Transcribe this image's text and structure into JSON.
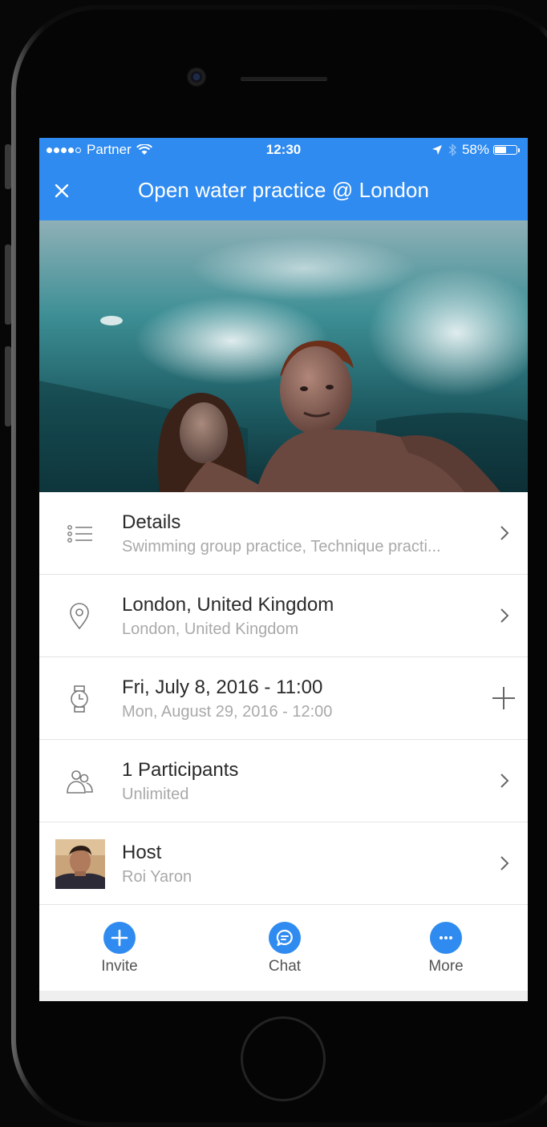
{
  "colors": {
    "accent": "#2f8bf0",
    "subtext": "#a9a9a9",
    "title": "#2a2a2a"
  },
  "status_bar": {
    "carrier": "Partner",
    "time": "12:30",
    "battery": "58%",
    "battery_level": 0.58
  },
  "header": {
    "title": "Open water practice @ London",
    "close_icon": "close-icon"
  },
  "hero": {
    "alt": "underwater swimmers photo"
  },
  "rows": [
    {
      "icon": "list-icon",
      "title": "Details",
      "subtitle": "Swimming group practice, Technique practi...",
      "action": "chevron-right-icon"
    },
    {
      "icon": "location-pin-icon",
      "title": "London, United Kingdom",
      "subtitle": "London, United Kingdom",
      "action": "chevron-right-icon"
    },
    {
      "icon": "watch-icon",
      "title": "Fri, July 8, 2016 - 11:00",
      "subtitle": "Mon, August 29, 2016 - 12:00",
      "action": "plus-icon"
    },
    {
      "icon": "people-icon",
      "title": "1 Participants",
      "subtitle": "Unlimited",
      "action": "chevron-right-icon"
    },
    {
      "icon": "avatar",
      "title": "Host",
      "subtitle": "Roi Yaron",
      "action": "chevron-right-icon"
    }
  ],
  "tabbar": [
    {
      "label": "Invite",
      "icon": "plus-icon"
    },
    {
      "label": "Chat",
      "icon": "chat-bubble-icon"
    },
    {
      "label": "More",
      "icon": "more-icon"
    }
  ]
}
